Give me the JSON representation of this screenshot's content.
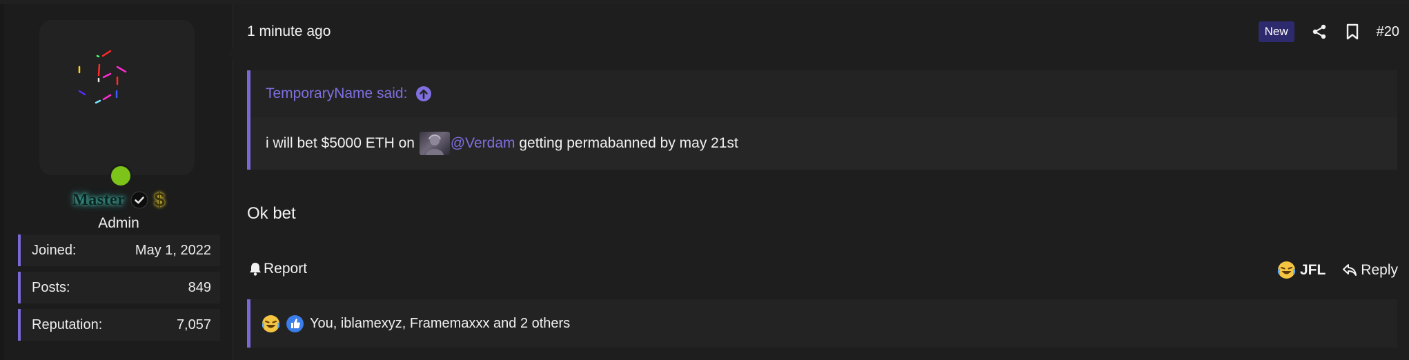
{
  "sidebar": {
    "username": "Master",
    "user_title": "Admin",
    "stats": [
      {
        "label": "Joined:",
        "value": "May 1, 2022"
      },
      {
        "label": "Posts:",
        "value": "849"
      },
      {
        "label": "Reputation:",
        "value": "7,057"
      }
    ],
    "status": "online",
    "icons": [
      "verified-badge-icon",
      "dollar-sign-icon"
    ],
    "colors": {
      "online": "#7cc31a",
      "accent": "#7b68d6"
    }
  },
  "post": {
    "date": "1 minute ago",
    "new_badge": "New",
    "number": "#20",
    "message": "Ok bet",
    "quote": {
      "author_said": "TemporaryName said:",
      "text_before": "i will bet $5000 ETH on ",
      "mention": "@Verdam",
      "text_after": " getting permabanned by may 21st"
    },
    "actions": {
      "report": "Report",
      "reaction": "JFL",
      "reply": "Reply"
    },
    "reactions_summary": "You, iblamexyz, Framemaxxx and 2 others"
  }
}
